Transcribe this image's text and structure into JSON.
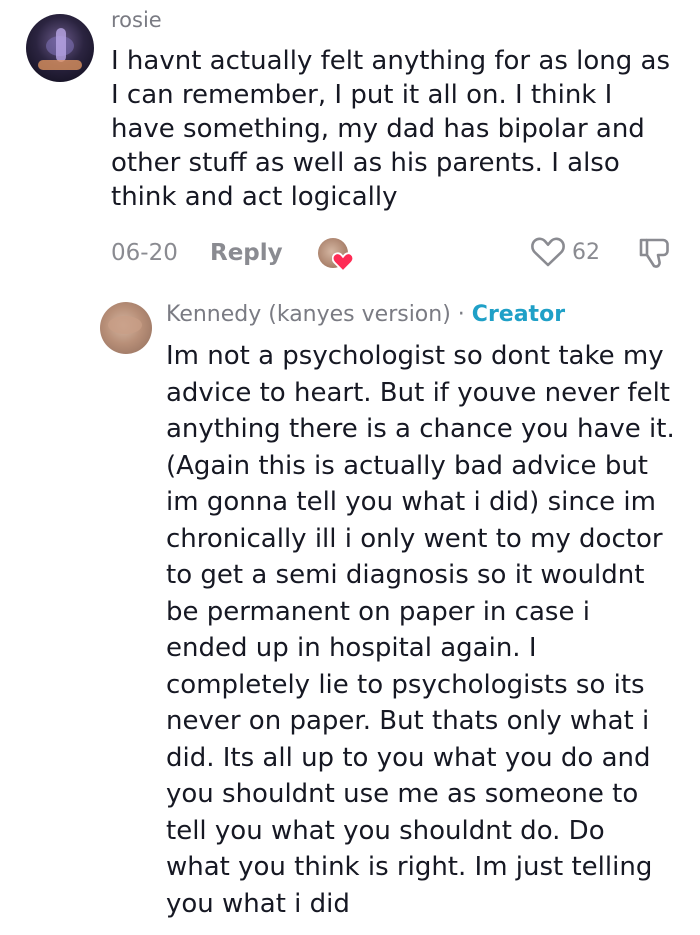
{
  "comment": {
    "username": "rosie",
    "text": "I havnt actually felt anything for as long as I can remember, I put it all on. I think I have something, my dad has bipolar and other stuff as well as his parents. I also think and act logically",
    "date": "06-20",
    "reply_label": "Reply",
    "like_count": "62",
    "icons": {
      "like": "heart-outline-icon",
      "dislike": "thumbs-down-icon",
      "creator_liked": "creator-liked-heart-icon"
    }
  },
  "reply": {
    "username": "Kennedy (kanyes version)",
    "separator": "·",
    "badge": "Creator",
    "text": "Im not a psychologist so dont take my advice to heart. But if youve never felt anything there is a chance you have it. (Again this is actually bad advice but im gonna tell you what i did) since im chronically ill i only went to my doctor to get a semi diagnosis so it wouldnt be permanent on paper in case i ended up in hospital again. I completely lie to psychologists so its never on paper. But thats only what i did. Its all up to you what you do and you shouldnt use me as someone to tell you what you shouldnt do. Do what you think is right. Im just telling you what i did"
  },
  "colors": {
    "creator_badge": "#1fa0c7",
    "heart_red": "#fe2c55",
    "meta_gray": "#8a8b91"
  }
}
